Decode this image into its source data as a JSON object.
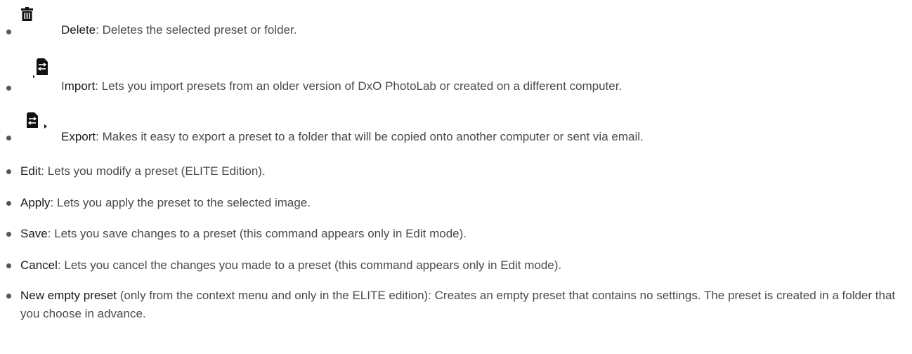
{
  "items": [
    {
      "term": "Delete",
      "desc": ": Deletes the selected preset or folder.",
      "icon": "trash-icon"
    },
    {
      "term_first": "I",
      "term": "mport",
      "desc": ": Lets you import presets from an older version of DxO PhotoLab or created on a different computer.",
      "icon": "import-icon"
    },
    {
      "term": "Export",
      "desc": ": Makes it easy to export a preset to a folder that will be copied onto another computer or sent via email.",
      "icon": "export-icon"
    },
    {
      "term": "Edit",
      "desc": ": Lets you modify a preset (ELITE Edition)."
    },
    {
      "term": "Apply",
      "desc": ": Lets you apply the preset to the selected image."
    },
    {
      "term": "Save",
      "desc": ": Lets you save changes to a preset (this command appears only in Edit mode)."
    },
    {
      "term": "Cancel",
      "desc": ": Lets you cancel the changes you made to a preset (this command appears only in Edit mode)."
    },
    {
      "term": "New empty preset",
      "desc": " (only from the context menu and only in the ELITE edition): Creates an empty preset that contains no settings. The preset is created in a folder that you choose in advance."
    }
  ]
}
